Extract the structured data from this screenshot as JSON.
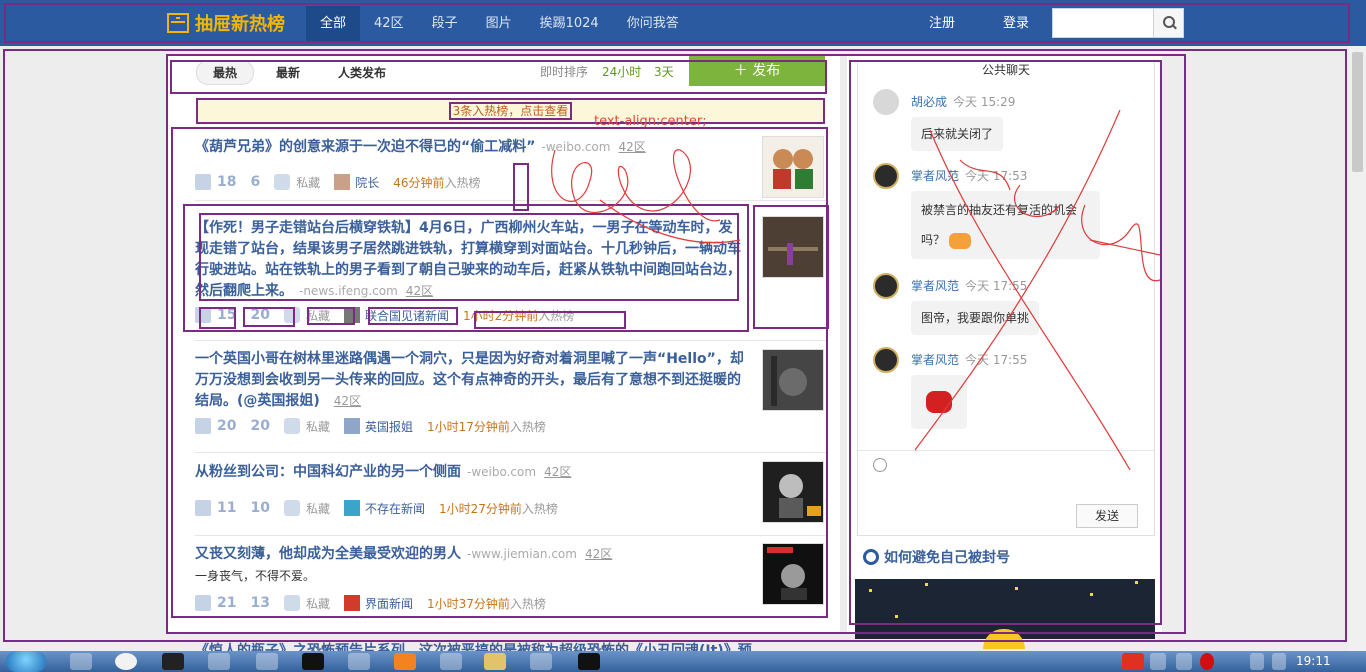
{
  "topbar": {
    "logo": "抽屉新热榜",
    "nav": [
      "全部",
      "42区",
      "段子",
      "图片",
      "挨踢1024",
      "你问我答"
    ],
    "register": "注册",
    "login": "登录",
    "search_placeholder": ""
  },
  "toolbar": {
    "tabs": [
      "最热",
      "最新",
      "人类发布"
    ],
    "sort_label": "即时排序",
    "sort_options": [
      "24小时",
      "3天"
    ],
    "publish": "发布"
  },
  "notice": "3条入热榜，点击查看",
  "annotation_text": "text-align:center;",
  "items": [
    {
      "title": "《葫芦兄弟》的创意来源于一次迫不得已的“偷工减料”",
      "source": "-weibo.com",
      "zone": "42区",
      "likes": "18",
      "comments": "6",
      "fav": "私藏",
      "user": "院长",
      "time": "46分钟前",
      "suffix": "入热榜"
    },
    {
      "title": "【作死！男子走错站台后横穿铁轨】4月6日，广西柳州火车站，一男子在等动车时，发现走错了站台，结果该男子居然跳进铁轨，打算横穿到对面站台。十几秒钟后，一辆动车行驶进站。站在铁轨上的男子看到了朝自己驶来的动车后，赶紧从铁轨中间跑回站台边，然后翻爬上来。",
      "source": "-news.ifeng.com",
      "zone": "42区",
      "likes": "15",
      "comments": "20",
      "fav": "私藏",
      "user": "联合国见诸新闻",
      "time": "1小时2分钟前",
      "suffix": "入热榜"
    },
    {
      "title": "一个英国小哥在树林里迷路偶遇一个洞穴，只是因为好奇对着洞里喊了一声“Hello”，却万万没想到会收到另一头传来的回应。这个有点神奇的开头，最后有了意想不到还挺暖的结局。(@英国报姐)",
      "source": "",
      "zone": "42区",
      "likes": "20",
      "comments": "20",
      "fav": "私藏",
      "user": "英国报姐",
      "time": "1小时17分钟前",
      "suffix": "入热榜"
    },
    {
      "title": "从粉丝到公司：中国科幻产业的另一个侧面",
      "source": "-weibo.com",
      "zone": "42区",
      "likes": "11",
      "comments": "10",
      "fav": "私藏",
      "user": "不存在新闻",
      "time": "1小时27分钟前",
      "suffix": "入热榜"
    },
    {
      "title": "又丧又刻薄，他却成为全美最受欢迎的男人",
      "source": "-www.jiemian.com",
      "zone": "42区",
      "subtitle": "一身丧气，不得不爱。",
      "likes": "21",
      "comments": "13",
      "fav": "私藏",
      "user": "界面新闻",
      "time": "1小时37分钟前",
      "suffix": "入热榜"
    }
  ],
  "next_item_peek": "《惊人的瓶子》之恐怖预告片系列，这次被恶搞的是被称为超级恐怖的《小丑回魂(It)》预",
  "sidebar": {
    "chat_title": "公共聊天",
    "messages": [
      {
        "user": "胡必成",
        "time": "今天 15:29",
        "text": "后来就关闭了"
      },
      {
        "user": "掌者风范",
        "time": "今天 17:53",
        "text": "被禁言的抽友还有复活的机会吗？"
      },
      {
        "user": "掌者风范",
        "time": "今天 17:55",
        "text": "图帝，我要跟你单挑"
      },
      {
        "user": "掌者风范",
        "time": "今天 17:55",
        "text": ""
      }
    ],
    "send": "发送",
    "tip": "如何避免自己被封号"
  },
  "taskbar": {
    "clock": "19:11"
  },
  "colors": {
    "topbar": "#2c5aa0",
    "annotation": "#7b2b82",
    "scribble": "#e03a3a",
    "publish": "#7db43e"
  }
}
